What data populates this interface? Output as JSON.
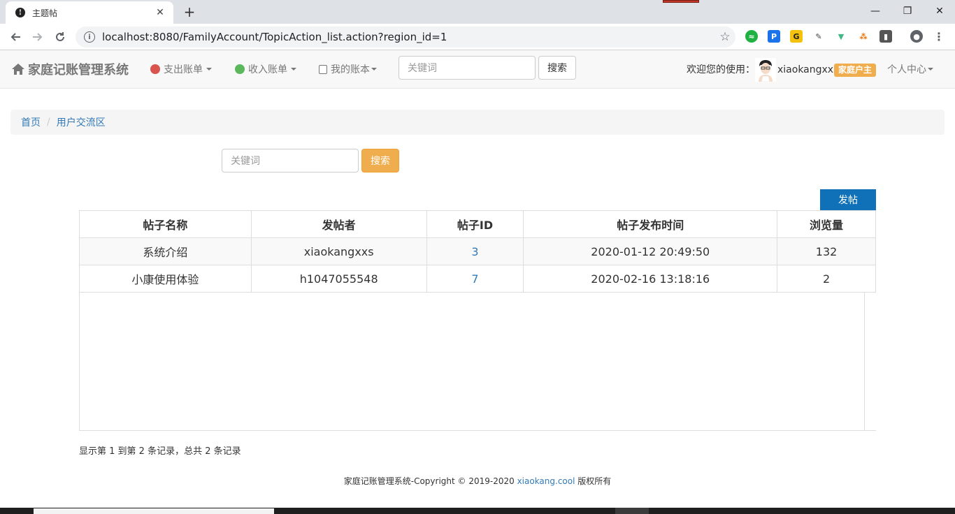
{
  "browser": {
    "tab_title": "主题帖",
    "tab_close": "✕",
    "new_tab": "+",
    "url": "localhost:8080/FamilyAccount/TopicAction_list.action?region_id=1",
    "window_controls": {
      "minimize": "—",
      "restore": "❐",
      "close": "✕"
    }
  },
  "navbar": {
    "brand": "家庭记账管理系统",
    "menus": [
      {
        "label": "支出账单",
        "icon": "money-bag-icon",
        "color": "#d9534f"
      },
      {
        "label": "收入账单",
        "icon": "money-bag-icon",
        "color": "#5cb85c"
      },
      {
        "label": "我的账本",
        "icon": "book-icon",
        "color": "#777777"
      }
    ],
    "search_placeholder": "关键词",
    "search_button": "搜索",
    "welcome": "欢迎您的使用：",
    "username": "xiaokangxxs",
    "role": "家庭户主",
    "personal_center": "个人中心"
  },
  "breadcrumb": [
    {
      "label": "首页"
    },
    {
      "label": "用户交流区"
    }
  ],
  "search": {
    "placeholder": "关键词",
    "button": "搜索"
  },
  "post_button": "发帖",
  "table": {
    "columns": [
      "帖子名称",
      "发帖者",
      "帖子ID",
      "帖子发布时间",
      "浏览量"
    ],
    "rows": [
      {
        "name": "系统介绍",
        "author": "xiaokangxxs",
        "id": "3",
        "time": "2020-01-12 20:49:50",
        "views": "132"
      },
      {
        "name": "小康使用体验",
        "author": "h1047055548",
        "id": "7",
        "time": "2020-02-16 13:18:16",
        "views": "2"
      }
    ]
  },
  "summary": "显示第 1 到第 2 条记录，总共 2 条记录",
  "footer": {
    "prefix": "家庭记账管理系统-Copyright © 2019-2020 ",
    "link": "xiaokang.cool",
    "suffix": " 版权所有"
  },
  "colors": {
    "link": "#337ab7",
    "warning": "#f0ad4e",
    "primary": "#1070b8"
  }
}
